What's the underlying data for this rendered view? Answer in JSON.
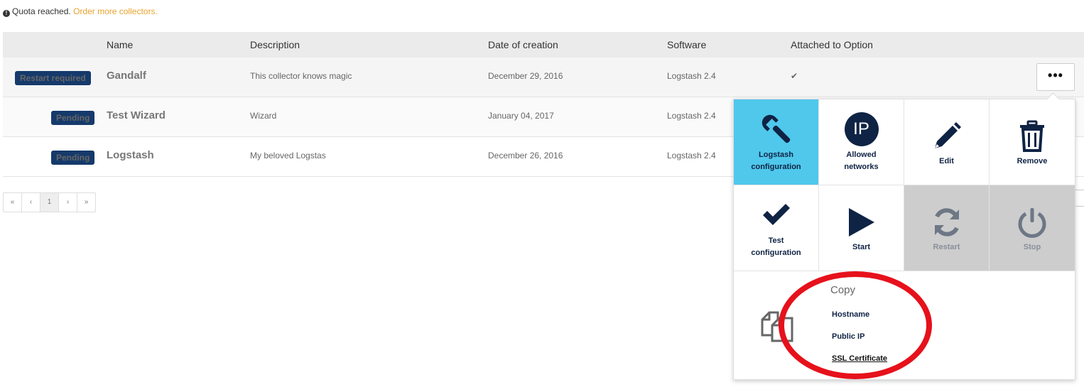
{
  "notice": {
    "text": "Quota reached.",
    "link": "Order more collectors.",
    "icon": "exclamation-circle-icon"
  },
  "table": {
    "headers": [
      "Name",
      "Description",
      "Date of creation",
      "Software",
      "Attached to Option"
    ],
    "rows": [
      {
        "status": "Restart required",
        "name": "Gandalf",
        "description": "This collector knows magic",
        "date": "December 29, 2016",
        "software": "Logstash 2.4",
        "attached": "✔"
      },
      {
        "status": "Pending",
        "name": "Test Wizard",
        "description": "Wizard",
        "date": "January 04, 2017",
        "software": "Logstash 2.4"
      },
      {
        "status": "Pending",
        "name": "Logstash",
        "description": "My beloved Logstas",
        "date": "December 26, 2016",
        "software": "Logstash 2.4"
      }
    ],
    "more_label": "•••"
  },
  "pagination": {
    "first": "«",
    "prev": "‹",
    "page": "1",
    "next": "›",
    "last": "»"
  },
  "menu": {
    "tiles": [
      {
        "label_1": "Logstash",
        "label_2": "configuration",
        "icon": "wrench-icon",
        "state": "active"
      },
      {
        "label_1": "Allowed",
        "label_2": "networks",
        "icon": "ip-icon",
        "icon_text": "IP"
      },
      {
        "label": "Edit",
        "icon": "pencil-icon"
      },
      {
        "label": "Remove",
        "icon": "trash-icon"
      },
      {
        "label_1": "Test",
        "label_2": "configuration",
        "icon": "check-icon"
      },
      {
        "label": "Start",
        "icon": "play-icon"
      },
      {
        "label": "Restart",
        "icon": "refresh-icon",
        "state": "disabled"
      },
      {
        "label": "Stop",
        "icon": "power-icon",
        "state": "disabled"
      }
    ],
    "copy": {
      "title": "Copy",
      "items": [
        "Hostname",
        "Public IP",
        "SSL Certificate"
      ],
      "icon": "copy-icon"
    }
  },
  "colors": {
    "badge": "#153a6b",
    "active_tile": "#4fc8ec",
    "disabled_tile": "#cdcdcd",
    "link": "#e8a32c",
    "annotation": "#e6111b"
  }
}
